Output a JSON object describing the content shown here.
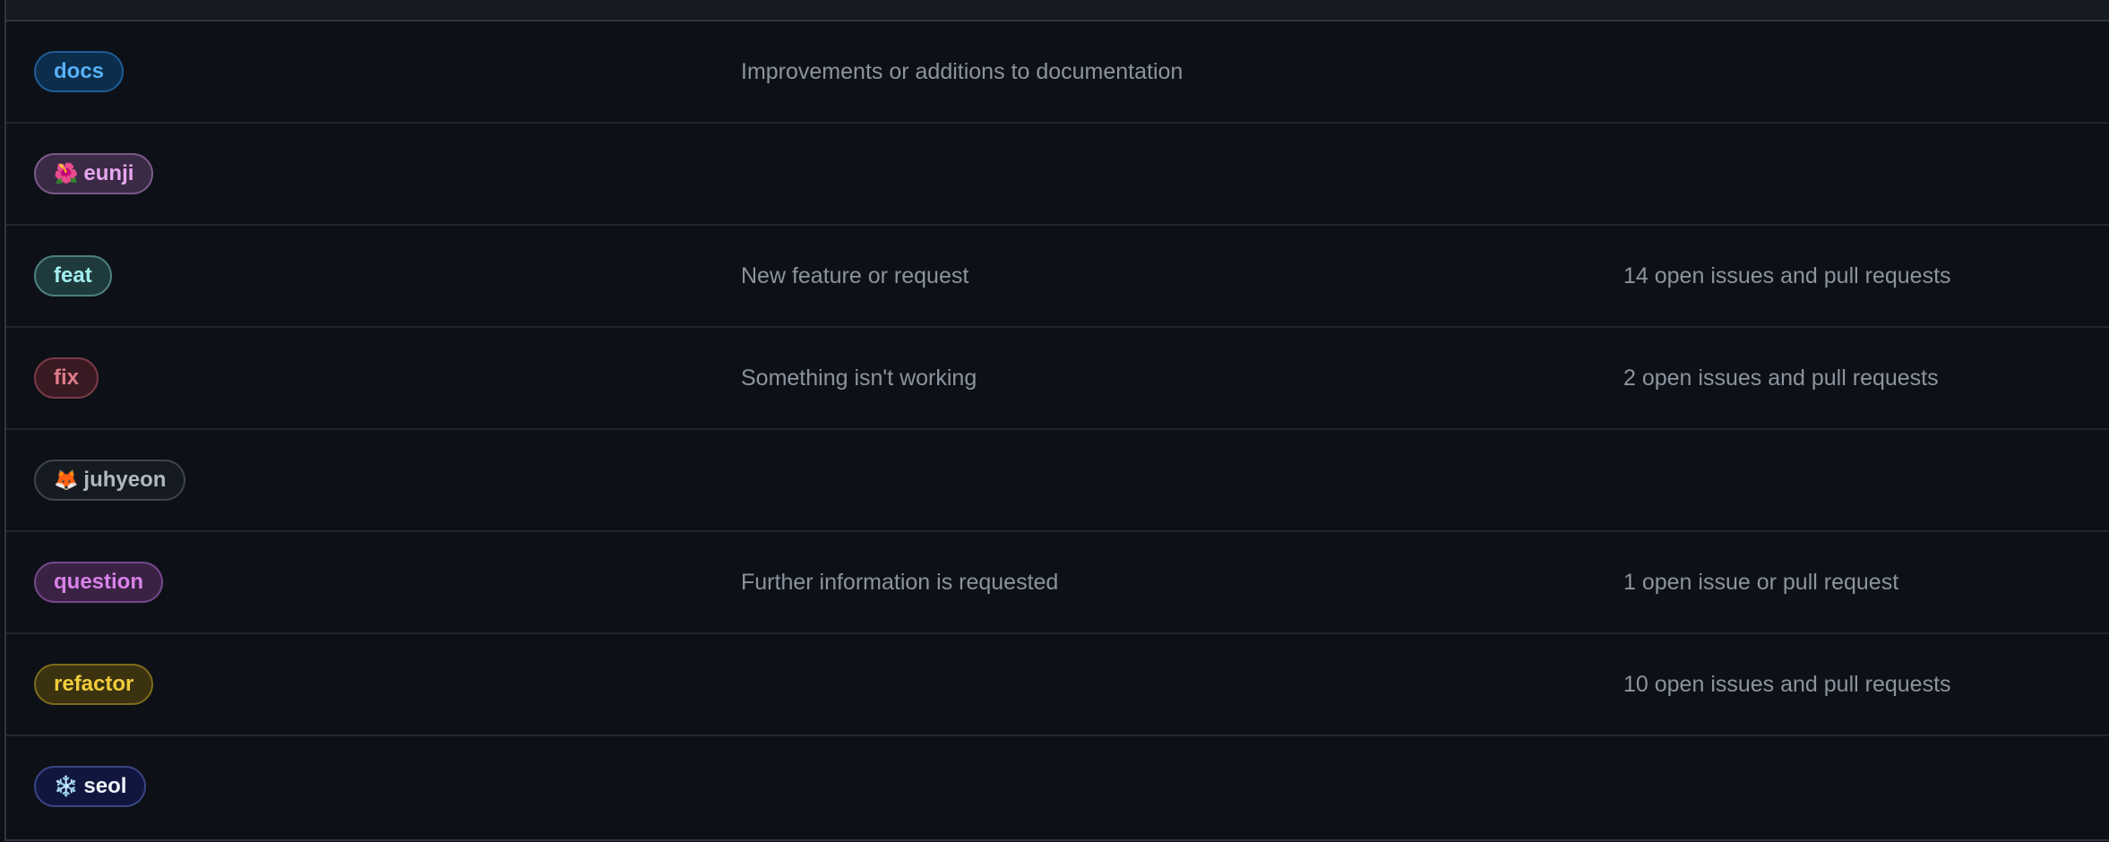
{
  "labels": [
    {
      "name": "docs",
      "emoji": "",
      "description": "Improvements or additions to documentation",
      "count": "",
      "colors": {
        "text": "#58b1f7",
        "bg": "#0c2d4b",
        "border": "#1f5c94"
      }
    },
    {
      "name": "eunji",
      "emoji": "🌺",
      "description": "",
      "count": "",
      "colors": {
        "text": "#e6a6ee",
        "bg": "#3b2a45",
        "border": "#7a5a88"
      }
    },
    {
      "name": "feat",
      "emoji": "",
      "description": "New feature or request",
      "count": "14 open issues and pull requests",
      "colors": {
        "text": "#a2eeef",
        "bg": "#1f3a3c",
        "border": "#4d7f80"
      }
    },
    {
      "name": "fix",
      "emoji": "",
      "description": "Something isn't working",
      "count": "2 open issues and pull requests",
      "colors": {
        "text": "#e07c8a",
        "bg": "#3a1a22",
        "border": "#7a3a47"
      }
    },
    {
      "name": "juhyeon",
      "emoji": "🦊",
      "description": "",
      "count": "",
      "colors": {
        "text": "#b1b8c0",
        "bg": "#161b22",
        "border": "#3d444d"
      }
    },
    {
      "name": "question",
      "emoji": "",
      "description": "Further information is requested",
      "count": "1 open issue or pull request",
      "colors": {
        "text": "#d982e8",
        "bg": "#3a2245",
        "border": "#74488a"
      }
    },
    {
      "name": "refactor",
      "emoji": "",
      "description": "",
      "count": "10 open issues and pull requests",
      "colors": {
        "text": "#f2cc3b",
        "bg": "#3b3210",
        "border": "#7c6a1c"
      }
    },
    {
      "name": "seol",
      "emoji": "❄️",
      "description": "",
      "count": "",
      "colors": {
        "text": "#f0f4ff",
        "bg": "#10163d",
        "border": "#3a4584"
      }
    }
  ]
}
